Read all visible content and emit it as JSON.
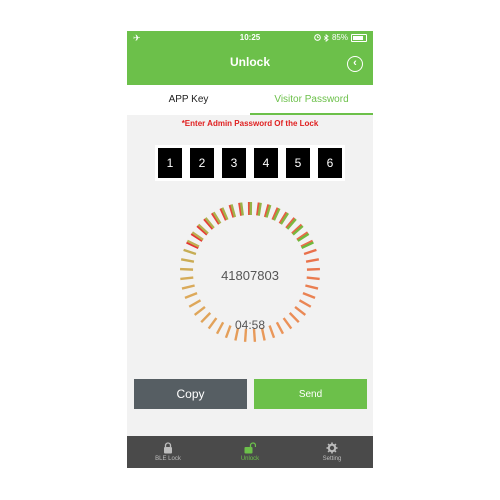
{
  "status_bar": {
    "airplane_icon": "✈",
    "time": "10:25",
    "battery": "85%"
  },
  "header": {
    "title": "Unlock",
    "back_icon": "back-arrow-circle"
  },
  "tabs": [
    {
      "label": "APP Key",
      "active": false
    },
    {
      "label": "Visitor Password",
      "active": true
    }
  ],
  "prompt": "*Enter Admin Password Of the Lock",
  "digits": [
    "1",
    "2",
    "3",
    "4",
    "5",
    "6"
  ],
  "gauge": {
    "code": "41807803",
    "timer": "04:58"
  },
  "buttons": {
    "copy": "Copy",
    "send": "Send"
  },
  "bottom_nav": [
    {
      "label": "BLE Lock",
      "icon": "lock-icon",
      "active": false
    },
    {
      "label": "Unlock",
      "icon": "unlock-icon",
      "active": true
    },
    {
      "label": "Setting",
      "icon": "gear-icon",
      "active": false
    }
  ],
  "colors": {
    "accent": "#6cc04a",
    "prompt": "#e02020",
    "copy_button": "#565e63",
    "bottom_bar": "#4a4a4a"
  }
}
